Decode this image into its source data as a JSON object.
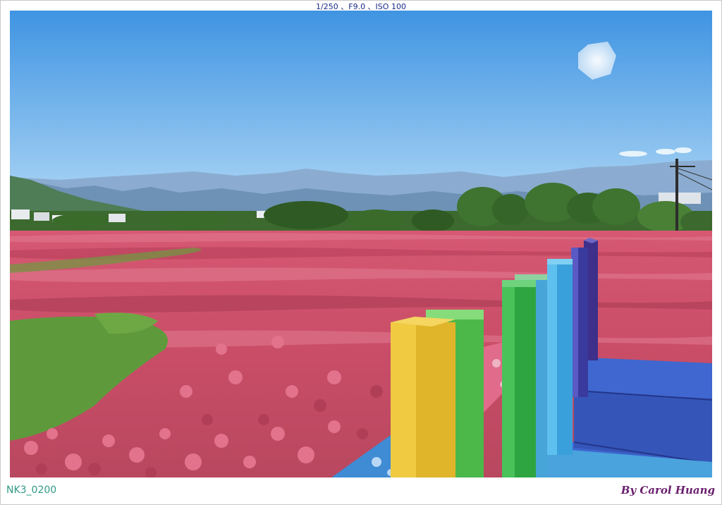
{
  "caption": {
    "exif": "1/250 、F9.0 、ISO 100",
    "code": "NK3_0200",
    "credit": "By Carol Huang"
  },
  "scene": {
    "sky_top": "#3f94e2",
    "sky_bottom": "#aed6f4",
    "mountain_far": "#8aaed0",
    "mountain_near": "#5d83a8",
    "tree_green": "#3d6b2c",
    "flower_pink": "#d9607a",
    "grass_green": "#5e9a3c",
    "fence_colors": [
      "#e8c132",
      "#4cb84a",
      "#3fb04a",
      "#45a7df",
      "#3e6fd1",
      "#4a3fa8",
      "#5c3d9e"
    ],
    "fence_rail": "#e06b8a",
    "deck_blue": "#3f67cf"
  }
}
